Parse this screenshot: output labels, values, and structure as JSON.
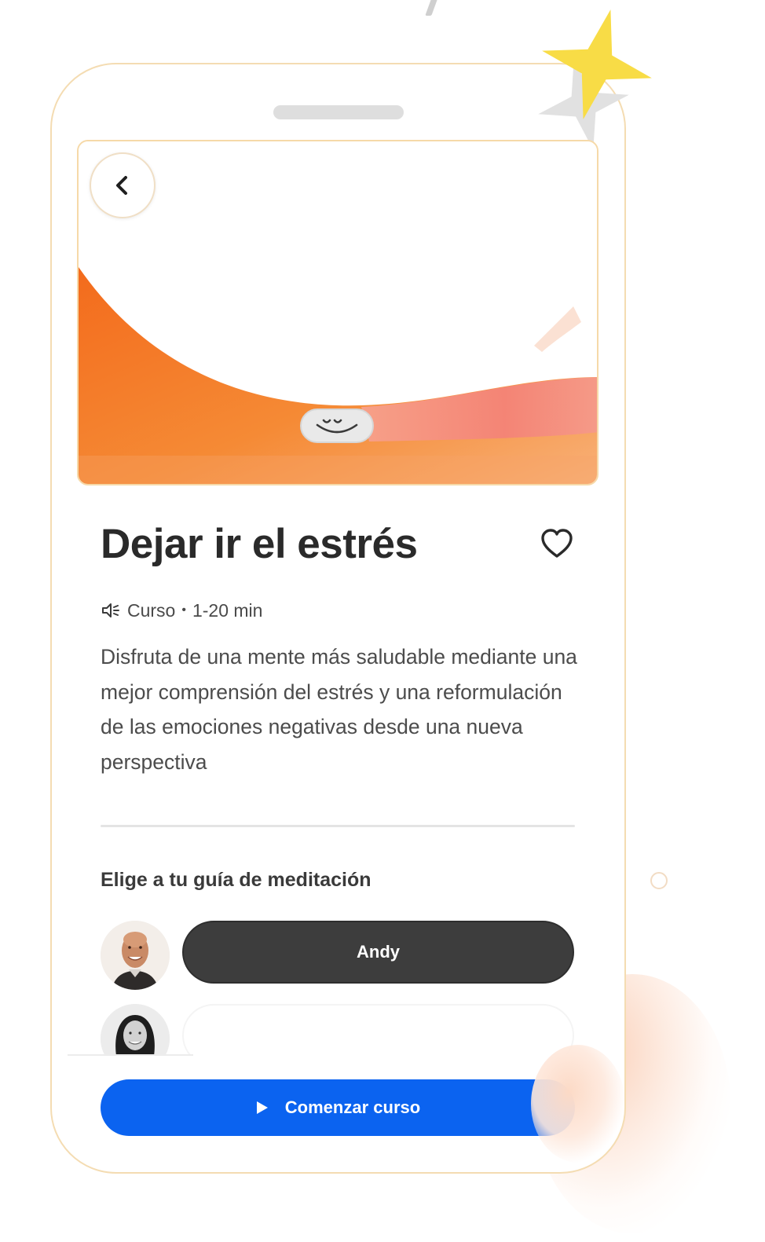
{
  "course": {
    "title": "Dejar ir el estrés",
    "type": "Curso",
    "separator": "•",
    "duration": "1-20 min",
    "description": "Disfruta de una mente más saludable mediante una mejor comprensión del estrés y una reformulación de las emociones negativas desde una nueva perspectiva"
  },
  "guides": {
    "heading": "Elige a tu guía de meditación",
    "options": [
      {
        "name": "Andy",
        "selected": true
      },
      {
        "name": "",
        "selected": false
      }
    ]
  },
  "cta": {
    "label": "Comenzar curso"
  },
  "icons": {
    "back": "chevron-left-icon",
    "favorite": "heart-outline-icon",
    "audio": "speaker-icon",
    "play": "play-icon",
    "brand": "smile-logo-icon"
  },
  "colors": {
    "accent_orange": "#f47a1f",
    "accent_coral": "#f28a78",
    "cta_blue": "#0b63f0",
    "selected_pill": "#3d3d3d",
    "star_yellow": "#f8dc46"
  }
}
